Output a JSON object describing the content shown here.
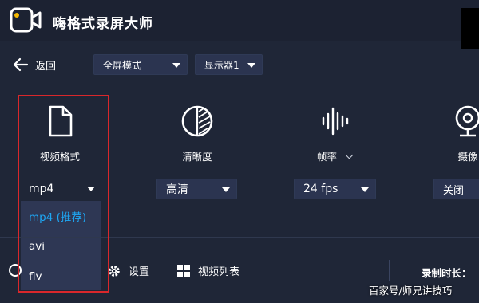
{
  "app": {
    "title": "嗨格式录屏大师"
  },
  "toolbar": {
    "back_label": "返回",
    "mode_select": {
      "value": "全屏模式"
    },
    "display_select": {
      "value": "显示器1"
    }
  },
  "options": {
    "format": {
      "label": "视频格式",
      "icon": "file-icon",
      "value": "mp4",
      "dropdown": [
        "mp4 (推荐)",
        "avi",
        "flv"
      ],
      "selected_index": 0
    },
    "quality": {
      "label": "清晰度",
      "icon": "contrast-icon",
      "value": "高清"
    },
    "fps": {
      "label": "帧率",
      "icon": "sound-wave-icon",
      "value": "24 fps"
    },
    "camera": {
      "label": "摄像",
      "icon": "webcam-icon",
      "value": "关闭"
    }
  },
  "bottom_bar": {
    "settings_label": "设置",
    "video_list_label": "视频列表",
    "duration_label": "录制时长："
  },
  "watermark": "百家号/师兄讲技巧",
  "colors": {
    "background": "#1f2637",
    "control": "#2b3450",
    "accent_selected": "#1ea7f4",
    "highlight_border": "#d9272b"
  }
}
